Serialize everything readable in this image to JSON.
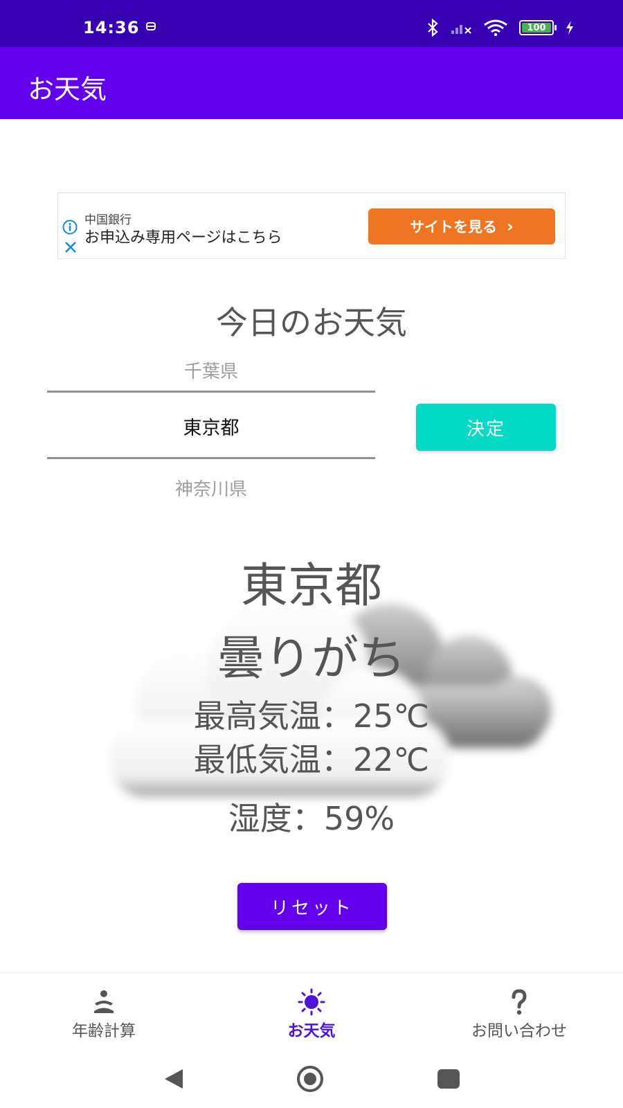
{
  "status_bar": {
    "time": "14:36",
    "battery_level": "100"
  },
  "app_bar": {
    "title": "お天気"
  },
  "ad": {
    "sponsor": "中国銀行",
    "headline": "お申込み専用ページはこちら",
    "cta_label": "サイトを見る",
    "cta_color": "#ee7623"
  },
  "main": {
    "title": "今日のお天気",
    "picker": {
      "prev": "千葉県",
      "current": "東京都",
      "next": "神奈川県"
    },
    "decide_label": "決定"
  },
  "weather": {
    "city": "東京都",
    "condition": "曇りがち",
    "temp_max": "最高気温：25℃",
    "temp_min": "最低気温：22℃",
    "humidity": "湿度：59%",
    "icon": "cloudy-icon"
  },
  "reset_label": "リセット",
  "bottom_nav": {
    "items": [
      {
        "label": "年齢計算",
        "icon": "meditation-icon",
        "active": false
      },
      {
        "label": "お天気",
        "icon": "sun-icon",
        "active": true
      },
      {
        "label": "お問い合わせ",
        "icon": "question-icon",
        "active": false
      }
    ]
  },
  "colors": {
    "status_bar": "#3700b3",
    "primary": "#6200ee",
    "accent": "#03dac5",
    "active_nav": "#4a14d8"
  }
}
